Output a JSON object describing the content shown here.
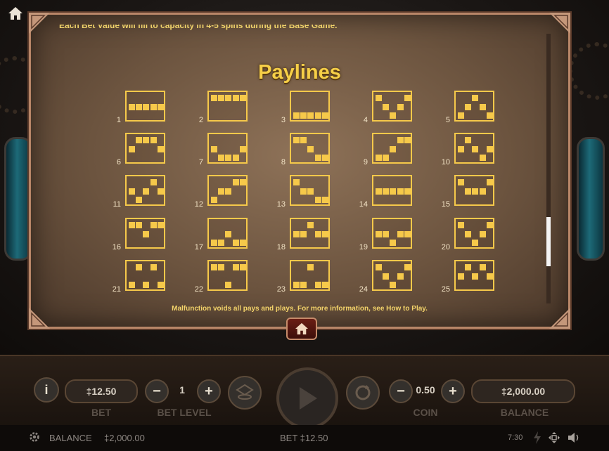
{
  "paytable": {
    "cut_text": "Each Bet Value will fill to capacity in 4-5 spins during the Base Game.",
    "title": "Paylines",
    "footer": "Malfunction voids all pays and plays.    For more information, see How to Play.",
    "scroll_position": 0.83,
    "paylines": [
      {
        "n": "1",
        "cells": [
          [
            1,
            0
          ],
          [
            1,
            1
          ],
          [
            1,
            2
          ],
          [
            1,
            3
          ],
          [
            1,
            4
          ]
        ]
      },
      {
        "n": "2",
        "cells": [
          [
            0,
            0
          ],
          [
            0,
            1
          ],
          [
            0,
            2
          ],
          [
            0,
            3
          ],
          [
            0,
            4
          ]
        ]
      },
      {
        "n": "3",
        "cells": [
          [
            2,
            0
          ],
          [
            2,
            1
          ],
          [
            2,
            2
          ],
          [
            2,
            3
          ],
          [
            2,
            4
          ]
        ]
      },
      {
        "n": "4",
        "cells": [
          [
            0,
            0
          ],
          [
            1,
            1
          ],
          [
            2,
            2
          ],
          [
            1,
            3
          ],
          [
            0,
            4
          ]
        ]
      },
      {
        "n": "5",
        "cells": [
          [
            2,
            0
          ],
          [
            1,
            1
          ],
          [
            0,
            2
          ],
          [
            1,
            3
          ],
          [
            2,
            4
          ]
        ]
      },
      {
        "n": "6",
        "cells": [
          [
            1,
            0
          ],
          [
            0,
            1
          ],
          [
            0,
            2
          ],
          [
            0,
            3
          ],
          [
            1,
            4
          ]
        ]
      },
      {
        "n": "7",
        "cells": [
          [
            1,
            0
          ],
          [
            2,
            1
          ],
          [
            2,
            2
          ],
          [
            2,
            3
          ],
          [
            1,
            4
          ]
        ]
      },
      {
        "n": "8",
        "cells": [
          [
            0,
            0
          ],
          [
            0,
            1
          ],
          [
            1,
            2
          ],
          [
            2,
            3
          ],
          [
            2,
            4
          ]
        ]
      },
      {
        "n": "9",
        "cells": [
          [
            2,
            0
          ],
          [
            2,
            1
          ],
          [
            1,
            2
          ],
          [
            0,
            3
          ],
          [
            0,
            4
          ]
        ]
      },
      {
        "n": "10",
        "cells": [
          [
            1,
            0
          ],
          [
            0,
            1
          ],
          [
            1,
            2
          ],
          [
            2,
            3
          ],
          [
            1,
            4
          ]
        ]
      },
      {
        "n": "11",
        "cells": [
          [
            1,
            0
          ],
          [
            2,
            1
          ],
          [
            1,
            2
          ],
          [
            0,
            3
          ],
          [
            1,
            4
          ]
        ]
      },
      {
        "n": "12",
        "cells": [
          [
            2,
            0
          ],
          [
            1,
            1
          ],
          [
            1,
            2
          ],
          [
            0,
            3
          ],
          [
            0,
            4
          ]
        ]
      },
      {
        "n": "13",
        "cells": [
          [
            0,
            0
          ],
          [
            1,
            1
          ],
          [
            1,
            2
          ],
          [
            2,
            3
          ],
          [
            2,
            4
          ]
        ]
      },
      {
        "n": "14",
        "cells": [
          [
            1,
            0
          ],
          [
            1,
            1
          ],
          [
            1,
            2
          ],
          [
            1,
            3
          ],
          [
            1,
            4
          ]
        ]
      },
      {
        "n": "15",
        "cells": [
          [
            0,
            0
          ],
          [
            1,
            1
          ],
          [
            1,
            2
          ],
          [
            1,
            3
          ],
          [
            0,
            4
          ]
        ]
      },
      {
        "n": "16",
        "cells": [
          [
            0,
            0
          ],
          [
            0,
            1
          ],
          [
            1,
            2
          ],
          [
            0,
            3
          ],
          [
            0,
            4
          ]
        ]
      },
      {
        "n": "17",
        "cells": [
          [
            2,
            0
          ],
          [
            2,
            1
          ],
          [
            1,
            2
          ],
          [
            2,
            3
          ],
          [
            2,
            4
          ]
        ]
      },
      {
        "n": "18",
        "cells": [
          [
            1,
            0
          ],
          [
            1,
            1
          ],
          [
            0,
            2
          ],
          [
            1,
            3
          ],
          [
            1,
            4
          ]
        ]
      },
      {
        "n": "19",
        "cells": [
          [
            1,
            0
          ],
          [
            1,
            1
          ],
          [
            2,
            2
          ],
          [
            1,
            3
          ],
          [
            1,
            4
          ]
        ]
      },
      {
        "n": "20",
        "cells": [
          [
            0,
            0
          ],
          [
            1,
            1
          ],
          [
            2,
            2
          ],
          [
            1,
            3
          ],
          [
            0,
            4
          ]
        ]
      },
      {
        "n": "21",
        "cells": [
          [
            2,
            0
          ],
          [
            0,
            1
          ],
          [
            2,
            2
          ],
          [
            0,
            3
          ],
          [
            2,
            4
          ]
        ]
      },
      {
        "n": "22",
        "cells": [
          [
            0,
            0
          ],
          [
            0,
            1
          ],
          [
            2,
            2
          ],
          [
            0,
            3
          ],
          [
            0,
            4
          ]
        ]
      },
      {
        "n": "23",
        "cells": [
          [
            2,
            0
          ],
          [
            2,
            1
          ],
          [
            0,
            2
          ],
          [
            2,
            3
          ],
          [
            2,
            4
          ]
        ]
      },
      {
        "n": "24",
        "cells": [
          [
            0,
            0
          ],
          [
            1,
            1
          ],
          [
            2,
            2
          ],
          [
            1,
            3
          ],
          [
            0,
            4
          ]
        ]
      },
      {
        "n": "25",
        "cells": [
          [
            1,
            0
          ],
          [
            0,
            1
          ],
          [
            1,
            2
          ],
          [
            0,
            3
          ],
          [
            1,
            4
          ]
        ]
      }
    ]
  },
  "controls": {
    "bet_value": "‡12.50",
    "bet_label": "BET",
    "bet_level_value": "1",
    "bet_level_label": "BET LEVEL",
    "coin_value": "0.50",
    "coin_label": "COIN",
    "balance_value": "‡2,000.00",
    "balance_label": "BALANCE",
    "minus": "−",
    "plus": "+",
    "info": "i"
  },
  "statusbar": {
    "balance_label": "BALANCE",
    "balance_value": "‡2,000.00",
    "bet_text": "BET ‡12.50",
    "clock": "7:30"
  },
  "colors": {
    "gold": "#f6c94a",
    "panel_border": "#b88668",
    "title": "#f6cf47"
  },
  "icons": [
    "home-icon",
    "gear-icon",
    "info-icon",
    "spin-icon",
    "autoplay-icon",
    "stack-icon",
    "lightning-icon",
    "fullscreen-icon",
    "speaker-icon"
  ]
}
